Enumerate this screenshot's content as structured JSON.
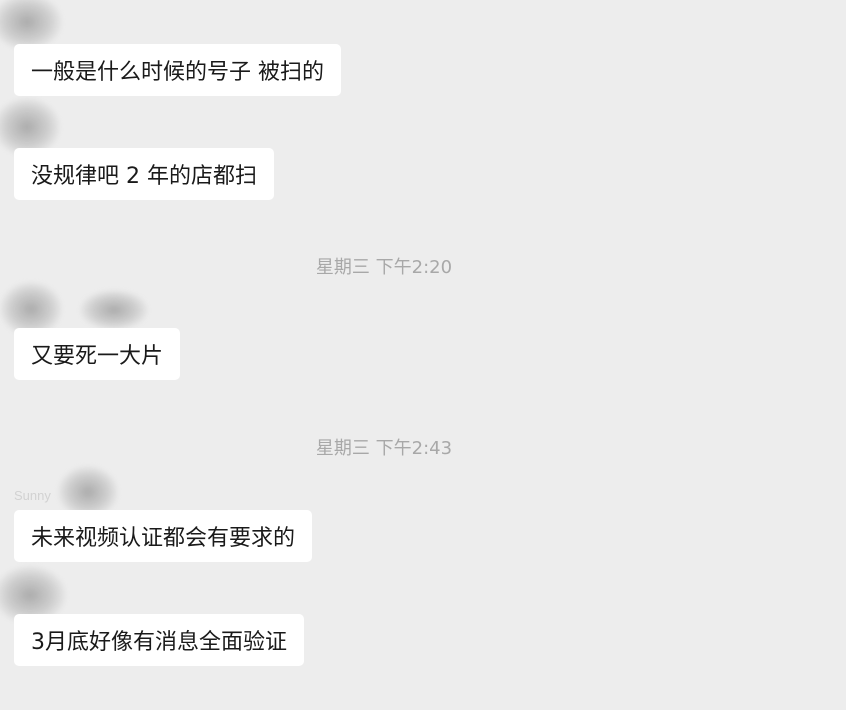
{
  "messages": [
    {
      "text": "一般是什么时候的号子 被扫的"
    },
    {
      "text": "没规律吧 2 年的店都扫"
    },
    {
      "text": "又要死一大片"
    },
    {
      "text": "未来视频认证都会有要求的"
    },
    {
      "text": "3月底好像有消息全面验证"
    }
  ],
  "timestamps": [
    {
      "text": "星期三 下午2:20"
    },
    {
      "text": "星期三 下午2:43"
    }
  ],
  "sender_names": [
    {
      "text": "Sunny"
    }
  ],
  "colors": {
    "background": "#ededed",
    "bubble": "#ffffff",
    "message_text": "#1a1a1a",
    "timestamp_text": "#a8a8a8"
  }
}
